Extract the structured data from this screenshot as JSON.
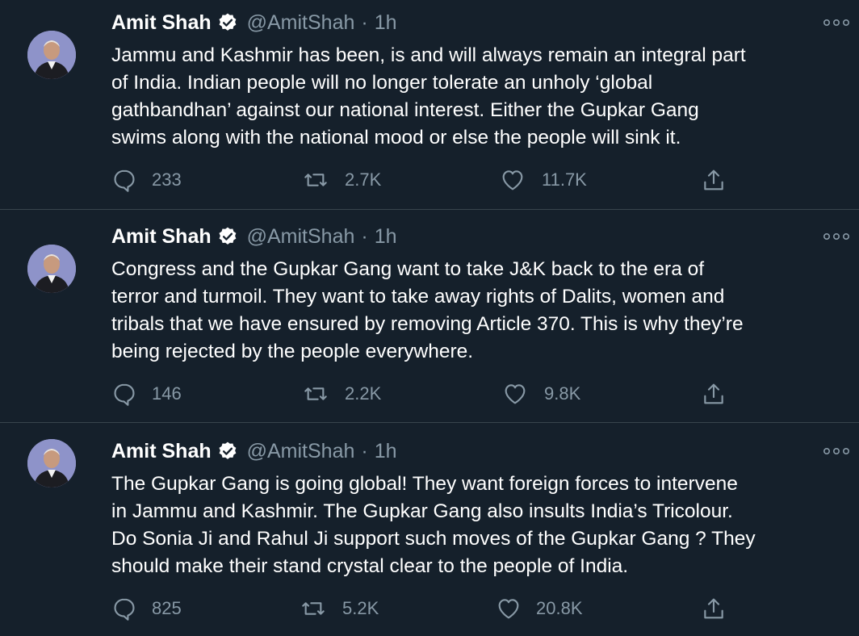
{
  "tweets": [
    {
      "author": {
        "name": "Amit Shah",
        "handle": "@AmitShah",
        "verified_icon": "verified-badge-icon"
      },
      "separator": "·",
      "time": "1h",
      "lines": [
        "Jammu and Kashmir has been, is and will always remain an integral part",
        "of India. Indian people will no longer tolerate an unholy ‘global",
        "gathbandhan’ against our national interest. Either the Gupkar Gang",
        "swims along with the national mood or else the people will sink it."
      ],
      "replies": "233",
      "retweets": "2.7K",
      "likes": "11.7K"
    },
    {
      "author": {
        "name": "Amit Shah",
        "handle": "@AmitShah",
        "verified_icon": "verified-badge-icon"
      },
      "separator": "·",
      "time": "1h",
      "lines": [
        "Congress and the Gupkar Gang want to take J&K back to the era of",
        "terror and turmoil. They want to take away rights of Dalits, women and",
        "tribals that we have ensured by removing Article 370. This is why they’re",
        "being rejected by the people everywhere."
      ],
      "replies": "146",
      "retweets": "2.2K",
      "likes": "9.8K"
    },
    {
      "author": {
        "name": "Amit Shah",
        "handle": "@AmitShah",
        "verified_icon": "verified-badge-icon"
      },
      "separator": "·",
      "time": "1h",
      "lines": [
        "The Gupkar Gang is going global! They want foreign forces to intervene",
        "in Jammu and Kashmir. The Gupkar Gang also insults India’s Tricolour.",
        "Do Sonia Ji and Rahul Ji support such moves of the Gupkar Gang ? They",
        "should make their stand crystal clear to the people of India."
      ],
      "replies": "825",
      "retweets": "5.2K",
      "likes": "20.8K"
    }
  ],
  "colors": {
    "background": "#15202b",
    "text": "#ffffff",
    "secondary": "#8899a6",
    "divider": "#38444d"
  }
}
